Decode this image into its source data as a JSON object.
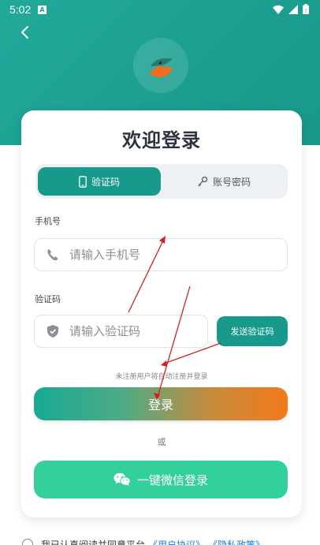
{
  "status_bar": {
    "time": "5:02",
    "notif_letter": "A"
  },
  "page": {
    "title": "欢迎登录"
  },
  "tabs": [
    {
      "label": "验证码",
      "icon": "phone-icon",
      "active": true
    },
    {
      "label": "账号密码",
      "icon": "key-icon",
      "active": false
    }
  ],
  "phone_field": {
    "label": "手机号",
    "placeholder": "请输入手机号",
    "value": ""
  },
  "code_field": {
    "label": "验证码",
    "placeholder": "请输入验证码",
    "value": ""
  },
  "send_code_label": "发送验证码",
  "hint": "未注册用户将自动注册并登录",
  "login_label": "登录",
  "or_label": "或",
  "wechat_label": "一键微信登录",
  "agreement": {
    "text": "我已认真阅读并同意平台",
    "user_agreement": "《用户协议》",
    "privacy_policy": "《隐私政策》"
  },
  "colors": {
    "brand": "#17998b",
    "accent_orange": "#f27a1c",
    "wechat_green": "#34d09a",
    "annotation_red": "#d32020"
  }
}
